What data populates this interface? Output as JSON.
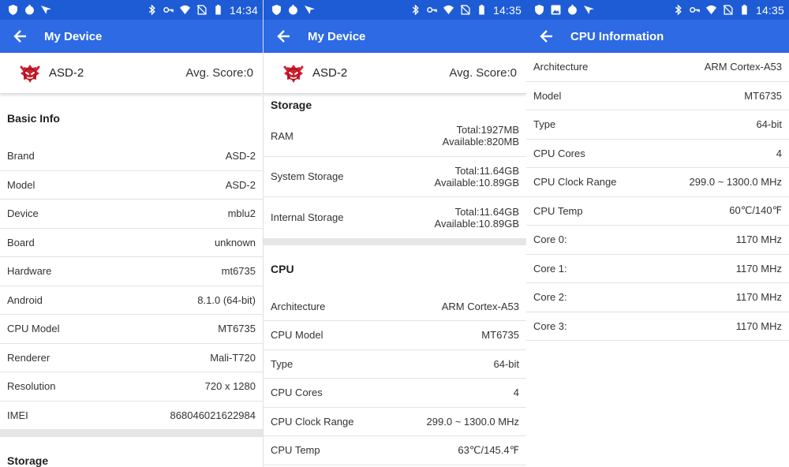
{
  "status": {
    "left_icons": [
      "shield-icon",
      "circle-icon",
      "send-icon"
    ],
    "right_icons": [
      "bluetooth-icon",
      "key-icon",
      "wifi-icon",
      "no-sim-icon",
      "battery-icon"
    ],
    "times": [
      "14:34",
      "14:35",
      "14:35"
    ]
  },
  "screen1": {
    "title": "My Device",
    "device_name": "ASD-2",
    "score": "Avg. Score:0",
    "basic_title": "Basic Info",
    "basic": [
      {
        "label": "Brand",
        "value": "ASD-2"
      },
      {
        "label": "Model",
        "value": "ASD-2"
      },
      {
        "label": "Device",
        "value": "mblu2"
      },
      {
        "label": "Board",
        "value": "unknown"
      },
      {
        "label": "Hardware",
        "value": "mt6735"
      },
      {
        "label": "Android",
        "value": "8.1.0 (64-bit)"
      },
      {
        "label": "CPU Model",
        "value": "MT6735"
      },
      {
        "label": "Renderer",
        "value": "Mali-T720"
      },
      {
        "label": "Resolution",
        "value": "720 x 1280"
      },
      {
        "label": "IMEI",
        "value": "868046021622984"
      }
    ],
    "storage_title": "Storage"
  },
  "screen2": {
    "title": "My Device",
    "device_name": "ASD-2",
    "score": "Avg. Score:0",
    "storage_title": "Storage",
    "storage": [
      {
        "label": "RAM",
        "total": "Total:1927MB",
        "available": "Available:820MB"
      },
      {
        "label": "System Storage",
        "total": "Total:11.64GB",
        "available": "Available:10.89GB"
      },
      {
        "label": "Internal Storage",
        "total": "Total:11.64GB",
        "available": "Available:10.89GB"
      }
    ],
    "cpu_title": "CPU",
    "cpu": [
      {
        "label": "Architecture",
        "value": "ARM Cortex-A53"
      },
      {
        "label": "CPU Model",
        "value": "MT6735"
      },
      {
        "label": "Type",
        "value": "64-bit"
      },
      {
        "label": "CPU Cores",
        "value": "4"
      },
      {
        "label": "CPU Clock Range",
        "value": "299.0 ~ 1300.0 MHz"
      },
      {
        "label": "CPU Temp",
        "value": "63℃/145.4℉"
      }
    ]
  },
  "screen3": {
    "title": "CPU Information",
    "rows": [
      {
        "label": "Architecture",
        "value": "ARM Cortex-A53"
      },
      {
        "label": "Model",
        "value": "MT6735"
      },
      {
        "label": "Type",
        "value": "64-bit"
      },
      {
        "label": "CPU Cores",
        "value": "4"
      },
      {
        "label": "CPU Clock Range",
        "value": "299.0 ~ 1300.0 MHz"
      },
      {
        "label": "CPU Temp",
        "value": "60℃/140℉"
      },
      {
        "label": "Core 0:",
        "value": "1170 MHz"
      },
      {
        "label": "Core 1:",
        "value": "1170 MHz"
      },
      {
        "label": "Core 2:",
        "value": "1170 MHz"
      },
      {
        "label": "Core 3:",
        "value": "1170 MHz"
      }
    ]
  },
  "colors": {
    "statusbar": "#1e5cd6",
    "appbar": "#2d6ae3",
    "logo_red": "#d0202f"
  }
}
